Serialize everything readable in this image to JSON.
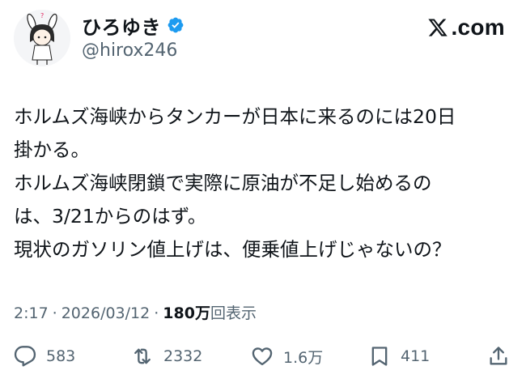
{
  "author": {
    "display_name": "ひろゆき",
    "handle": "@hirox246",
    "verified": true,
    "verified_color": "#1d9bf0"
  },
  "brand": {
    "label": ".com",
    "icon": "x-logo-icon"
  },
  "post": {
    "lines": [
      "ホルムズ海峡からタンカーが日本に来るのには20日",
      "掛かる。",
      "ホルムズ海峡閉鎖で実際に原油が不足し始めるの",
      "は、3/21からのはず。",
      "現状のガソリン値上げは、便乗値上げじゃないの？"
    ]
  },
  "meta": {
    "time": "2:17",
    "separator": "·",
    "date": "2026/03/12",
    "views_count": "180万",
    "views_label": "回表示"
  },
  "actions": {
    "reply_count": "583",
    "repost_count": "2332",
    "like_count": "1.6万",
    "bookmark_count": "411"
  },
  "colors": {
    "text": "#0f1419",
    "secondary": "#536471",
    "accent": "#1d9bf0"
  }
}
